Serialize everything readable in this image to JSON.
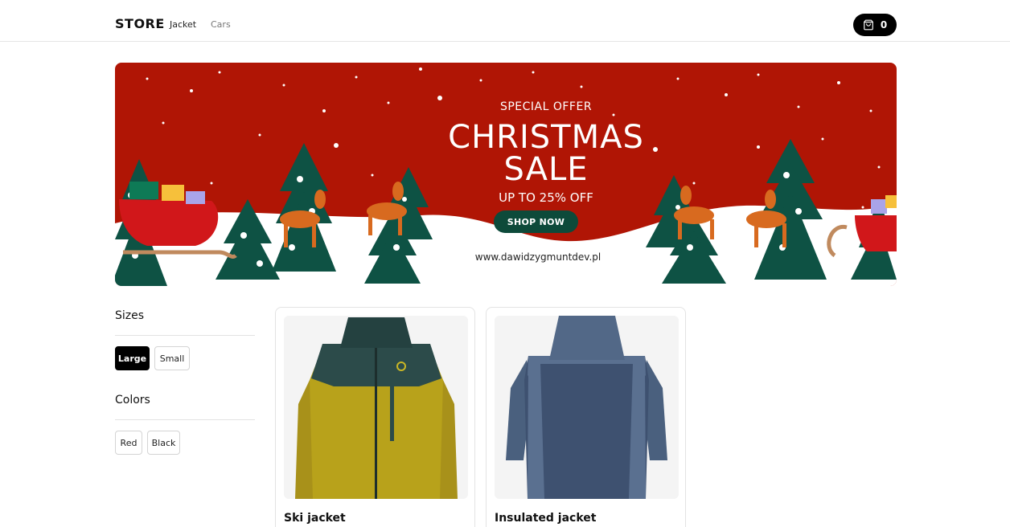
{
  "header": {
    "brand": "STORE",
    "nav": [
      "Jacket",
      "Cars"
    ],
    "cart_count": "0"
  },
  "banner": {
    "special": "SPECIAL OFFER",
    "line1": "CHRISTMAS",
    "line2": "SALE",
    "discount": "UP TO 25% OFF",
    "cta": "SHOP NOW",
    "url": "www.dawidzygmuntdev.pl",
    "colors": {
      "background": "#b01505",
      "button": "#0d4a3a"
    }
  },
  "filters": {
    "sizes_title": "Sizes",
    "sizes": [
      "Large",
      "Small"
    ],
    "selected_size": "Large",
    "colors_title": "Colors",
    "colors": [
      "Red",
      "Black"
    ]
  },
  "products": [
    {
      "name": "Ski jacket"
    },
    {
      "name": "Insulated jacket"
    }
  ]
}
